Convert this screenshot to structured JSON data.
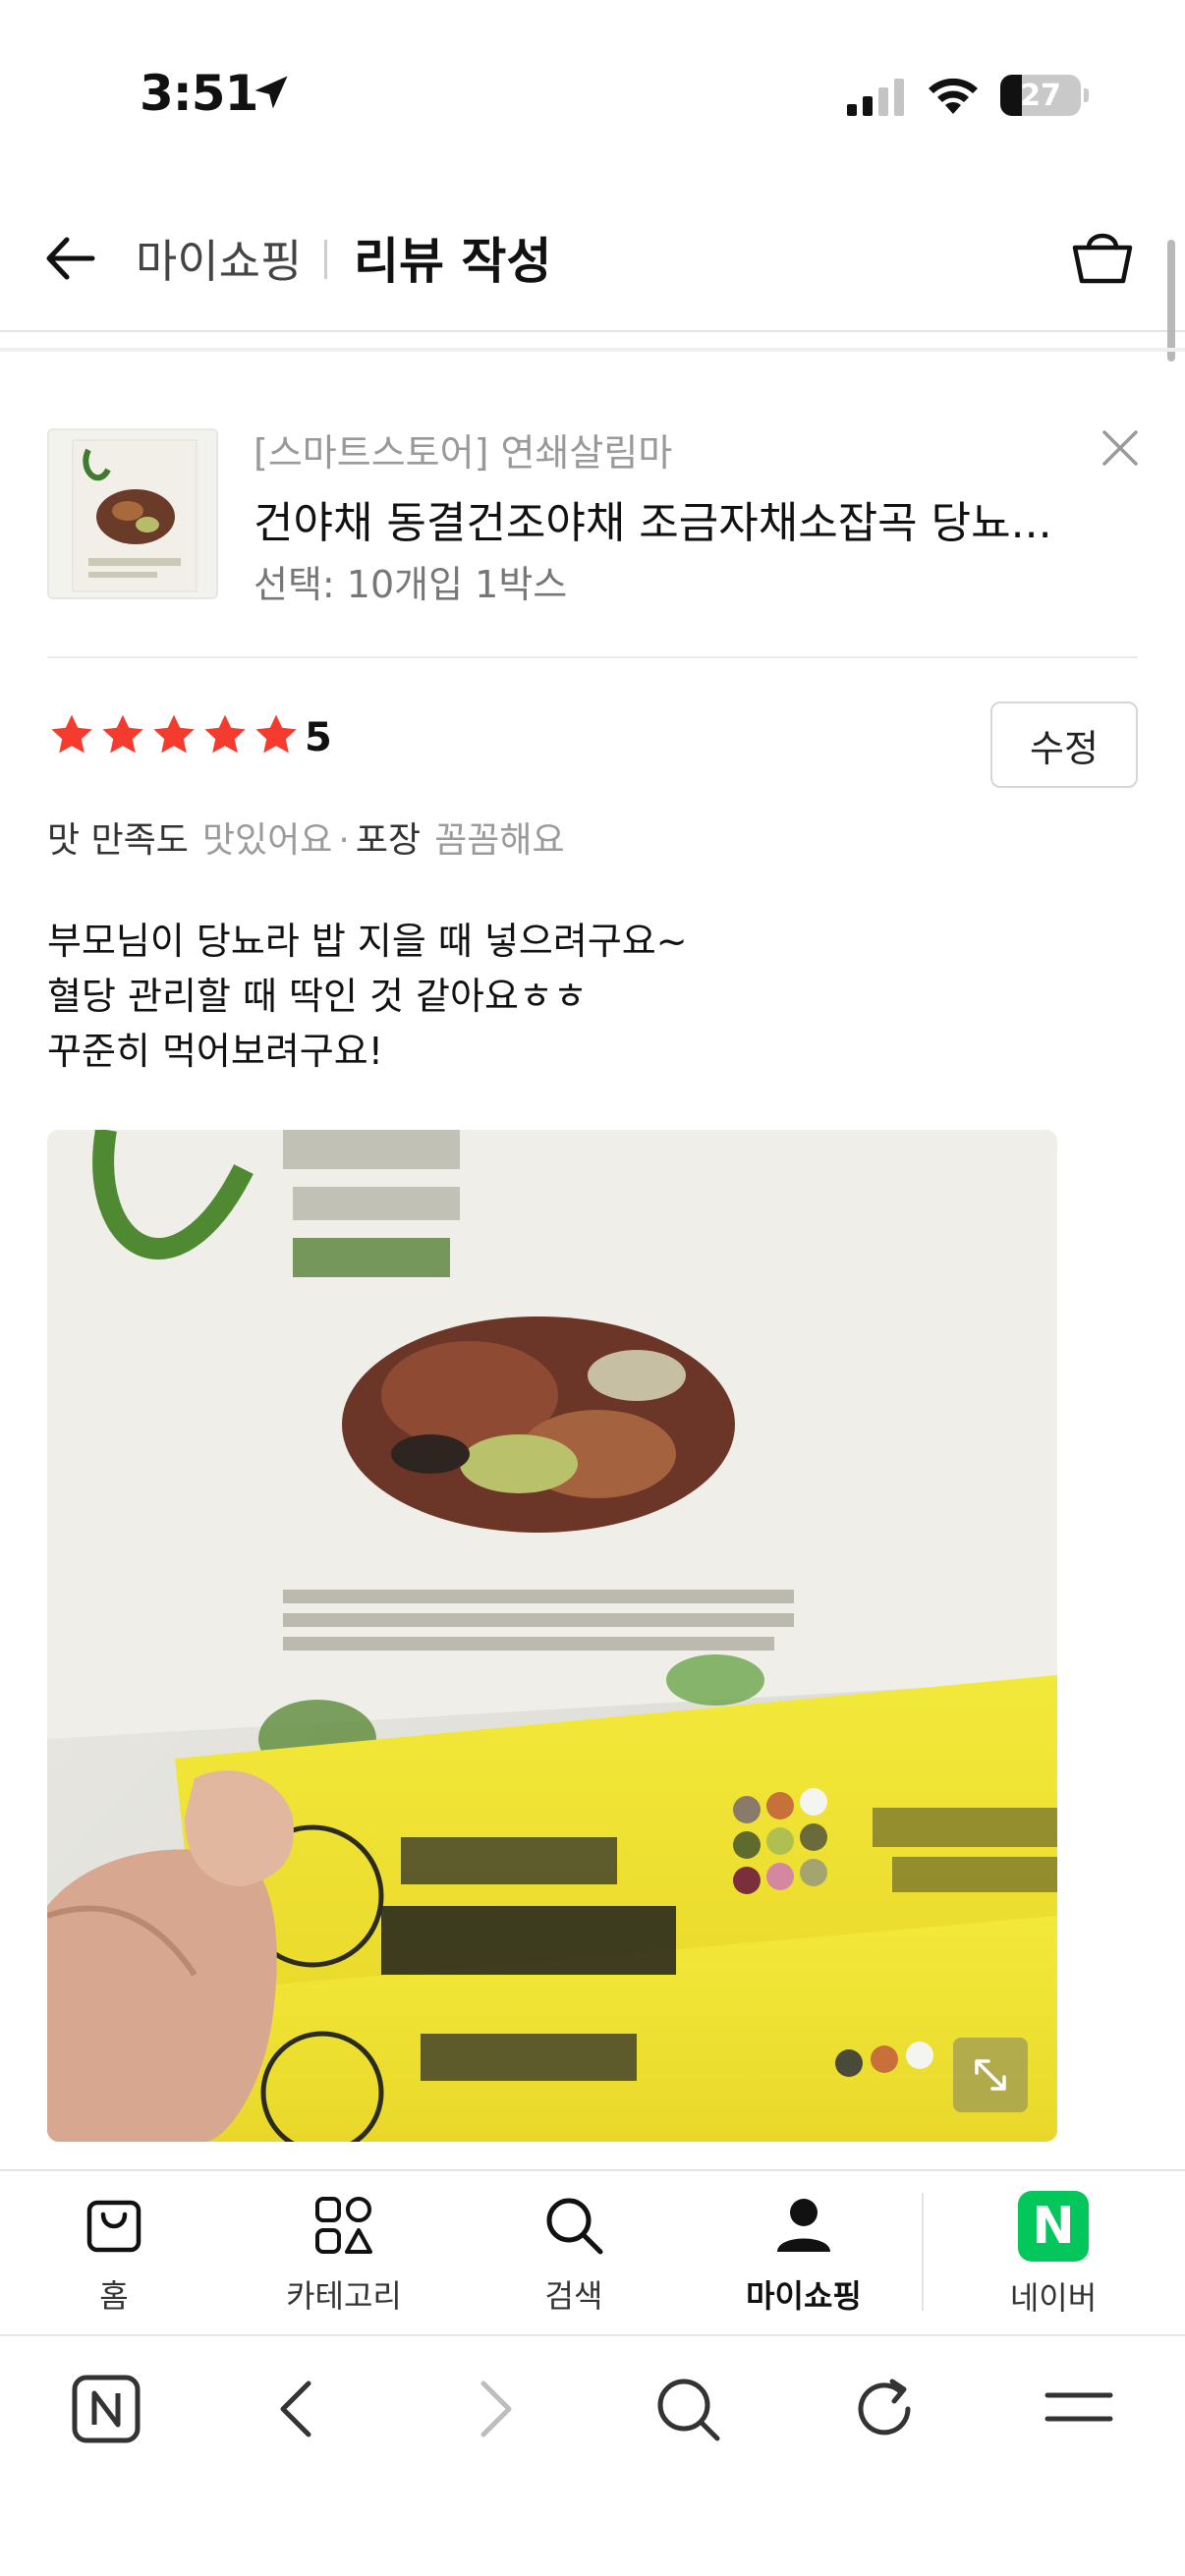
{
  "status_bar": {
    "time": "3:51",
    "battery": "27"
  },
  "header": {
    "crumb": "마이쇼핑",
    "title": "리뷰 작성"
  },
  "product": {
    "store": "[스마트스토어] 연쇄살림마",
    "name": "건야채 동결건조야채 조금자채소잡곡 당뇨...",
    "option": "선택: 10개입 1박스"
  },
  "rating": {
    "score": "5",
    "stars": 5,
    "edit_label": "수정"
  },
  "tags": [
    {
      "key": "맛 만족도",
      "value": "맛있어요"
    },
    {
      "key": "포장",
      "value": "꼼꼼해요"
    }
  ],
  "review_lines": [
    "부모님이 당뇨라 밥 지을 때 넣으려구요~",
    "혈당 관리할 때 딱인 것 같아요ㅎㅎ",
    "꾸준히 먹어보려구요!"
  ],
  "tabbar": {
    "home": "홈",
    "category": "카테고리",
    "search": "검색",
    "myshopping": "마이쇼핑",
    "naver": "네이버",
    "naver_logo": "N"
  },
  "colors": {
    "star": "#f43b2e",
    "naver_green": "#03c75a"
  }
}
